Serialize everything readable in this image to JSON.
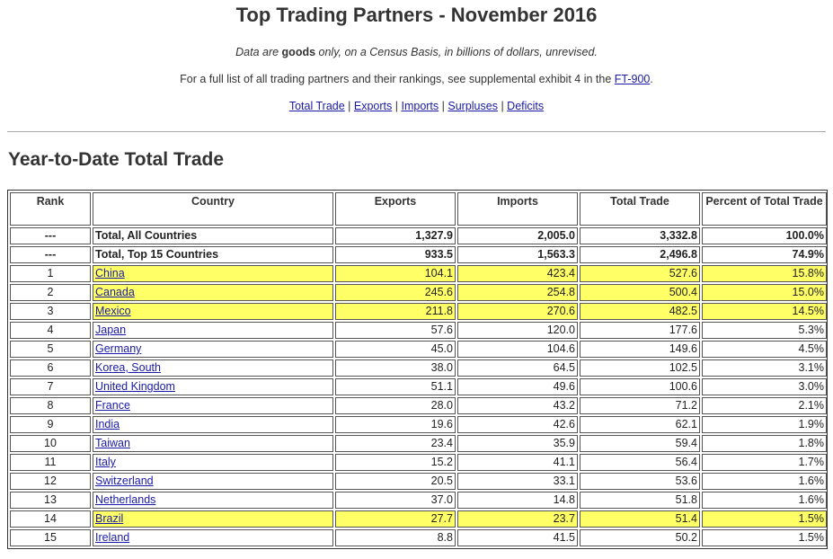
{
  "page": {
    "title": "Top Trading Partners - November 2016",
    "note": {
      "prefix": "Data are ",
      "bold": "goods",
      "suffix": " only, on a Census Basis, in billions of dollars, unrevised."
    },
    "full_list": {
      "prefix": "For a full list of all trading partners and their rankings, see supplemental exhibit 4 in the ",
      "link": "FT-900",
      "suffix": "."
    },
    "nav": [
      "Total Trade",
      "Exports",
      "Imports",
      "Surpluses",
      "Deficits"
    ],
    "nav_separator": " | ",
    "section_title": "Year-to-Date Total Trade"
  },
  "table": {
    "headers": [
      "Rank",
      "Country",
      "Exports",
      "Imports",
      "Total Trade",
      "Percent of Total Trade"
    ],
    "total_rows": [
      {
        "rank": "---",
        "country": "Total, All Countries",
        "exports": "1,327.9",
        "imports": "2,005.0",
        "total": "3,332.8",
        "percent": "100.0%"
      },
      {
        "rank": "---",
        "country": "Total, Top 15 Countries",
        "exports": "933.5",
        "imports": "1,563.3",
        "total": "2,496.8",
        "percent": "74.9%"
      }
    ],
    "rows": [
      {
        "rank": "1",
        "country": "China",
        "exports": "104.1",
        "imports": "423.4",
        "total": "527.6",
        "percent": "15.8%",
        "highlight": true
      },
      {
        "rank": "2",
        "country": "Canada",
        "exports": "245.6",
        "imports": "254.8",
        "total": "500.4",
        "percent": "15.0%",
        "highlight": true
      },
      {
        "rank": "3",
        "country": "Mexico",
        "exports": "211.8",
        "imports": "270.6",
        "total": "482.5",
        "percent": "14.5%",
        "highlight": true
      },
      {
        "rank": "4",
        "country": "Japan",
        "exports": "57.6",
        "imports": "120.0",
        "total": "177.6",
        "percent": "5.3%",
        "highlight": false
      },
      {
        "rank": "5",
        "country": "Germany",
        "exports": "45.0",
        "imports": "104.6",
        "total": "149.6",
        "percent": "4.5%",
        "highlight": false
      },
      {
        "rank": "6",
        "country": "Korea, South",
        "exports": "38.0",
        "imports": "64.5",
        "total": "102.5",
        "percent": "3.1%",
        "highlight": false
      },
      {
        "rank": "7",
        "country": "United Kingdom",
        "exports": "51.1",
        "imports": "49.6",
        "total": "100.6",
        "percent": "3.0%",
        "highlight": false
      },
      {
        "rank": "8",
        "country": "France",
        "exports": "28.0",
        "imports": "43.2",
        "total": "71.2",
        "percent": "2.1%",
        "highlight": false
      },
      {
        "rank": "9",
        "country": "India",
        "exports": "19.6",
        "imports": "42.6",
        "total": "62.1",
        "percent": "1.9%",
        "highlight": false
      },
      {
        "rank": "10",
        "country": "Taiwan",
        "exports": "23.4",
        "imports": "35.9",
        "total": "59.4",
        "percent": "1.8%",
        "highlight": false
      },
      {
        "rank": "11",
        "country": "Italy",
        "exports": "15.2",
        "imports": "41.1",
        "total": "56.4",
        "percent": "1.7%",
        "highlight": false
      },
      {
        "rank": "12",
        "country": "Switzerland",
        "exports": "20.5",
        "imports": "33.1",
        "total": "53.6",
        "percent": "1.6%",
        "highlight": false
      },
      {
        "rank": "13",
        "country": "Netherlands",
        "exports": "37.0",
        "imports": "14.8",
        "total": "51.8",
        "percent": "1.6%",
        "highlight": false
      },
      {
        "rank": "14",
        "country": "Brazil",
        "exports": "27.7",
        "imports": "23.7",
        "total": "51.4",
        "percent": "1.5%",
        "highlight": true
      },
      {
        "rank": "15",
        "country": "Ireland",
        "exports": "8.8",
        "imports": "41.5",
        "total": "50.2",
        "percent": "1.5%",
        "highlight": false
      }
    ]
  },
  "colors": {
    "highlight": "#ffff66",
    "link": "#1a1aa6"
  }
}
